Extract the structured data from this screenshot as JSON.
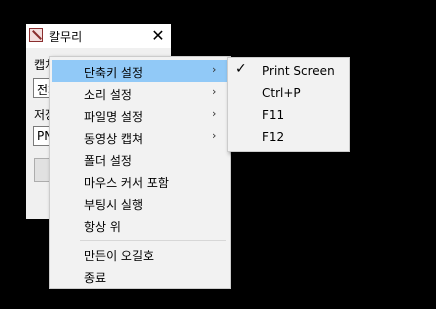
{
  "window": {
    "title": "칼무리",
    "label1": "캡처",
    "field1_value": "전체",
    "label2": "저장",
    "field2_value": "PNG"
  },
  "context_menu": {
    "items": [
      {
        "label": "단축키 설정",
        "has_submenu": true,
        "highlighted": true
      },
      {
        "label": "소리 설정",
        "has_submenu": true
      },
      {
        "label": "파일명 설정",
        "has_submenu": true
      },
      {
        "label": "동영상 캡쳐",
        "has_submenu": true
      },
      {
        "label": "폴더 설정"
      },
      {
        "label": "마우스 커서 포함"
      },
      {
        "label": "부팅시 실행"
      },
      {
        "label": "항상 위"
      },
      {
        "label": "만든이 오길호"
      },
      {
        "label": "종료"
      }
    ],
    "submenu_arrow": "›"
  },
  "hotkey_submenu": {
    "items": [
      {
        "label": "Print Screen",
        "checked": true
      },
      {
        "label": "Ctrl+P"
      },
      {
        "label": "F11"
      },
      {
        "label": "F12"
      }
    ],
    "check_glyph": "✓"
  }
}
